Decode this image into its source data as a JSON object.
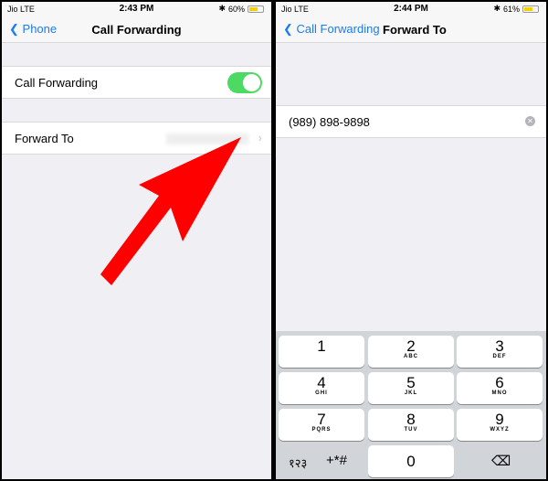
{
  "left": {
    "status": {
      "carrier": "Jio",
      "network": "LTE",
      "time": "2:43 PM",
      "battery": "60%",
      "battery_level": 0.6
    },
    "nav": {
      "back": "Phone",
      "title": "Call Forwarding"
    },
    "call_forwarding": {
      "label": "Call Forwarding",
      "enabled": true
    },
    "forward_to": {
      "label": "Forward To"
    },
    "arrow_color": "#ff0000"
  },
  "right": {
    "status": {
      "carrier": "Jio",
      "network": "LTE",
      "time": "2:44 PM",
      "battery": "61%",
      "battery_level": 0.61
    },
    "nav": {
      "back": "Call Forwarding",
      "title": "Forward To"
    },
    "phone_field": {
      "value": "(989) 898-9898"
    },
    "keypad": {
      "keys": [
        {
          "n": "1",
          "s": ""
        },
        {
          "n": "2",
          "s": "ABC"
        },
        {
          "n": "3",
          "s": "DEF"
        },
        {
          "n": "4",
          "s": "GHI"
        },
        {
          "n": "5",
          "s": "JKL"
        },
        {
          "n": "6",
          "s": "MNO"
        },
        {
          "n": "7",
          "s": "PQRS"
        },
        {
          "n": "8",
          "s": "TUV"
        },
        {
          "n": "9",
          "s": "WXYZ"
        },
        {
          "n": "0",
          "s": ""
        }
      ],
      "lang_key": "१२३",
      "symbols_key": "+*#"
    }
  },
  "colors": {
    "accent": "#1a7cf5",
    "toggle_on": "#4cd964"
  }
}
